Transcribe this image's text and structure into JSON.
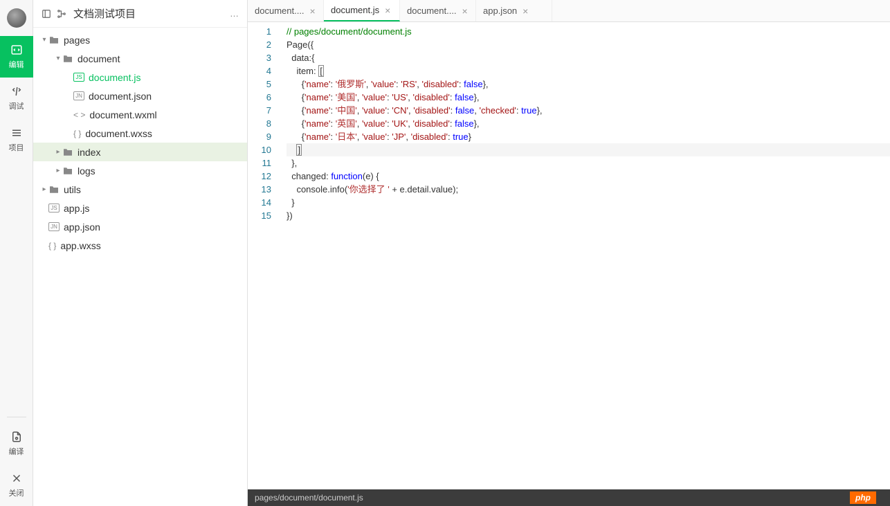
{
  "leftbar": {
    "items": [
      {
        "name": "edit",
        "label": "编辑",
        "active": true
      },
      {
        "name": "debug",
        "label": "调试",
        "active": false
      },
      {
        "name": "project",
        "label": "项目",
        "active": false
      }
    ],
    "bottom": [
      {
        "name": "compile",
        "label": "编译"
      },
      {
        "name": "close",
        "label": "关闭"
      }
    ]
  },
  "sidebar": {
    "title": "文档测试项目",
    "more": "…",
    "tree": {
      "pages": {
        "label": "pages",
        "type": "folder",
        "expanded": true
      },
      "document": {
        "label": "document",
        "type": "folder",
        "expanded": true
      },
      "doc_js": {
        "label": "document.js",
        "icon": "JS",
        "active": true
      },
      "doc_json": {
        "label": "document.json",
        "icon": "JN"
      },
      "doc_wxml": {
        "label": "document.wxml",
        "icon": "<>"
      },
      "doc_wxss": {
        "label": "document.wxss",
        "icon": "{}"
      },
      "index": {
        "label": "index",
        "type": "folder",
        "expanded": false,
        "selected": true
      },
      "logs": {
        "label": "logs",
        "type": "folder",
        "expanded": false
      },
      "utils": {
        "label": "utils",
        "type": "folder",
        "expanded": false
      },
      "app_js": {
        "label": "app.js",
        "icon": "JS"
      },
      "app_json": {
        "label": "app.json",
        "icon": "JN"
      },
      "app_wxss": {
        "label": "app.wxss",
        "icon": "{}"
      }
    }
  },
  "tabs": [
    {
      "label": "document....",
      "active": false
    },
    {
      "label": "document.js",
      "active": true
    },
    {
      "label": "document....",
      "active": false
    },
    {
      "label": "app.json",
      "active": false
    }
  ],
  "code": {
    "lines": 15,
    "content": [
      {
        "n": 1,
        "type": "comment",
        "text": "// pages/document/document.js"
      },
      {
        "n": 2,
        "type": "plain",
        "text": "Page({"
      },
      {
        "n": 3,
        "type": "plain",
        "text": "  data:{"
      },
      {
        "n": 4,
        "type": "item_open",
        "text": "    item: ",
        "bracket": "["
      },
      {
        "n": 5,
        "type": "obj",
        "indent": "      ",
        "name": "俄罗斯",
        "value": "RS",
        "disabled": false
      },
      {
        "n": 6,
        "type": "obj",
        "indent": "      ",
        "name": "美国",
        "value": "US",
        "disabled": false
      },
      {
        "n": 7,
        "type": "obj",
        "indent": "      ",
        "name": "中国",
        "value": "CN",
        "disabled": false,
        "checked": true
      },
      {
        "n": 8,
        "type": "obj",
        "indent": "      ",
        "name": "英国",
        "value": "UK",
        "disabled": false
      },
      {
        "n": 9,
        "type": "obj",
        "indent": "      ",
        "name": "日本",
        "value": "JP",
        "disabled": true,
        "last": true
      },
      {
        "n": 10,
        "type": "close_bracket",
        "text": "    ",
        "bracket": "]",
        "hl": true
      },
      {
        "n": 11,
        "type": "plain",
        "text": "  },"
      },
      {
        "n": 12,
        "type": "func",
        "text": "  changed: ",
        "kw": "function",
        "tail": "(e) {"
      },
      {
        "n": 13,
        "type": "log",
        "indent": "    ",
        "call": "console.info(",
        "str": "你选择了 ",
        "tail": " + e.detail.value);"
      },
      {
        "n": 14,
        "type": "plain",
        "text": "  }"
      },
      {
        "n": 15,
        "type": "plain",
        "text": "})"
      }
    ]
  },
  "statusbar": {
    "path": "pages/document/document.js",
    "badge": "php"
  }
}
